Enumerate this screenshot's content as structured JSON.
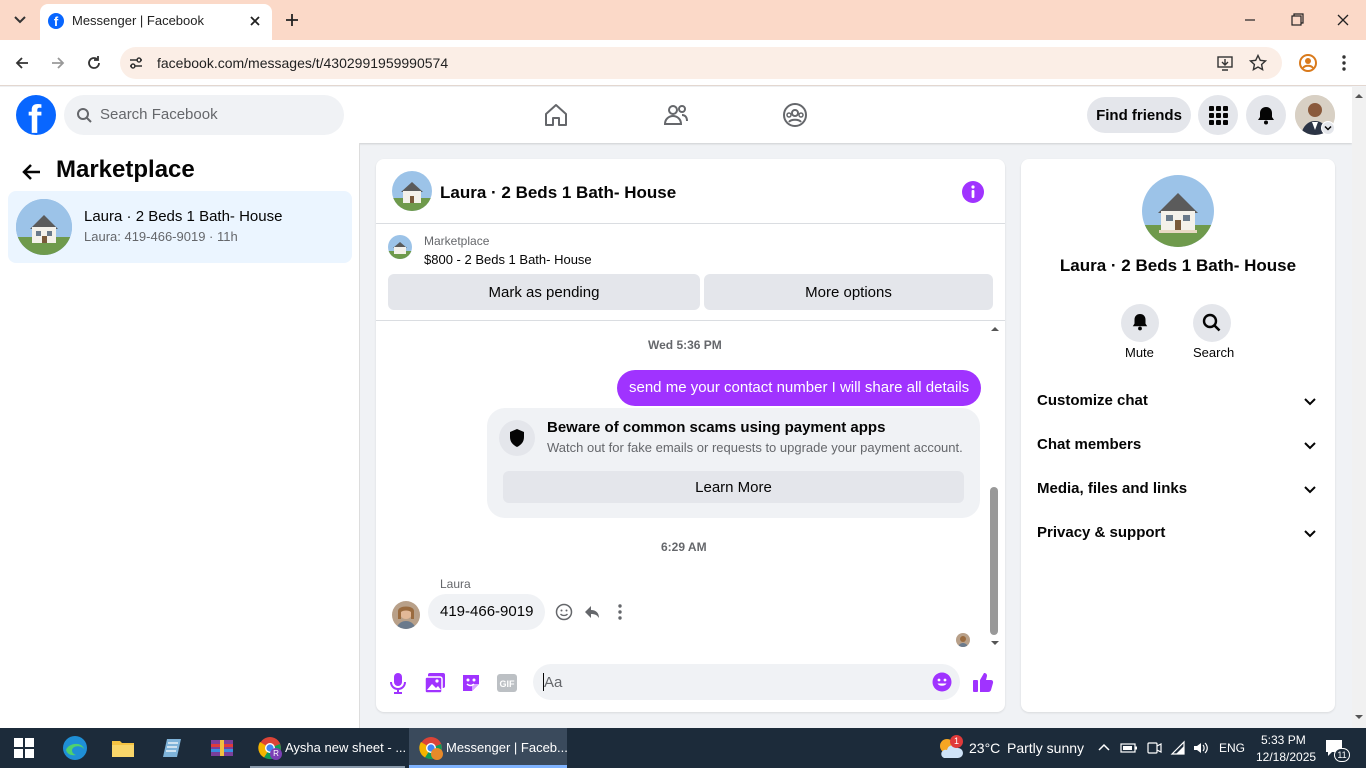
{
  "browser": {
    "tab_title": "Messenger | Facebook",
    "url": "facebook.com/messages/t/4302991959990574"
  },
  "header": {
    "search_placeholder": "Search Facebook",
    "find_friends": "Find friends"
  },
  "sidebar": {
    "title": "Marketplace",
    "conversation": {
      "title": "Laura · 2 Beds 1 Bath- House",
      "preview": "Laura: 419-466-9019 · 11h"
    }
  },
  "chat": {
    "title": "Laura · 2 Beds 1 Bath- House",
    "listing": {
      "source": "Marketplace",
      "summary": "$800 - 2 Beds 1 Bath- House"
    },
    "mark_pending": "Mark as pending",
    "more_options": "More options",
    "timestamp1": "Wed 5:36 PM",
    "outgoing_message": "send me your contact number I will share all details",
    "scam_notice": {
      "title": "Beware of common scams using payment apps",
      "body": "Watch out for fake emails or requests to upgrade your payment account.",
      "button": "Learn More"
    },
    "timestamp2": "6:29 AM",
    "sender_name": "Laura",
    "incoming_message": "419-466-9019",
    "composer_placeholder": "Aa"
  },
  "details": {
    "title": "Laura · 2 Beds 1 Bath- House",
    "mute": "Mute",
    "search": "Search",
    "sections": [
      "Customize chat",
      "Chat members",
      "Media, files and links",
      "Privacy & support"
    ]
  },
  "taskbar": {
    "app1": "Aysha new sheet - ...",
    "app2": "Messenger | Faceb...",
    "temperature": "23°C",
    "weather": "Partly sunny",
    "language": "ENG",
    "time": "5:33 PM",
    "date": "12/18/2025",
    "notif_count": "11",
    "weather_badge": "1"
  },
  "colors": {
    "brand": "#0866ff",
    "messenger_purple": "#a033ff",
    "tabbar": "#fbd9c8",
    "taskbar": "#1c2b3a"
  }
}
